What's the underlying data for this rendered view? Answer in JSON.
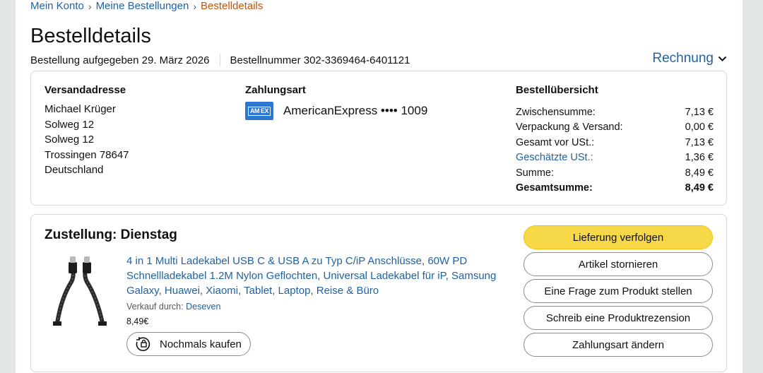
{
  "breadcrumb": {
    "item1": "Mein Konto",
    "item2": "Meine Bestellungen",
    "current": "Bestelldetails",
    "separator": "›"
  },
  "page_title": "Bestelldetails",
  "order_meta": {
    "placed": "Bestellung aufgegeben 29. März 2026",
    "number": "Bestellnummer 302-3369464-6401121"
  },
  "invoice_label": "Rechnung",
  "shipping": {
    "heading": "Versandadresse",
    "lines": [
      "Michael Krüger",
      "Solweg 12",
      "Solweg 12",
      "Trossingen 78647",
      "Deutschland"
    ]
  },
  "payment": {
    "heading": "Zahlungsart",
    "card_logo": "AM EX",
    "card": "AmericanExpress •••• 1009"
  },
  "overview": {
    "heading": "Bestellübersicht",
    "rows": [
      {
        "label": "Zwischensumme:",
        "value": "7,13 €"
      },
      {
        "label": "Verpackung & Versand:",
        "value": "0,00 €"
      },
      {
        "label": "Gesamt vor USt.:",
        "value": "7,13 €"
      },
      {
        "label": "Geschätzte USt.:",
        "value": "1,36 €"
      },
      {
        "label": "Summe:",
        "value": "8,49 €"
      },
      {
        "label": "Gesamtsumme:",
        "value": "8,49 €"
      }
    ]
  },
  "delivery": {
    "heading": "Zustellung: Dienstag",
    "product_title": "4 in 1 Multi Ladekabel USB C & USB A zu Typ C/iP Anschlüsse, 60W PD Schnellladekabel 1.2M Nylon Geflochten, Universal Ladekabel für iP, Samsung Galaxy, Huawei, Xiaomi, Tablet, Laptop, Reise & Büro",
    "seller_label": "Verkauf durch:",
    "seller_name": "Deseven",
    "price": "8,49€",
    "rebuy_label": "Nochmals kaufen"
  },
  "actions": {
    "track": "Lieferung verfolgen",
    "cancel": "Artikel stornieren",
    "question": "Eine Frage zum Produkt stellen",
    "review": "Schreib eine Produktrezension",
    "change_payment": "Zahlungsart ändern"
  },
  "colors": {
    "link": "#2162a1",
    "breadcrumb_current": "#c45500",
    "primary_button": "#f7d849",
    "amex": "#2e77d0"
  }
}
